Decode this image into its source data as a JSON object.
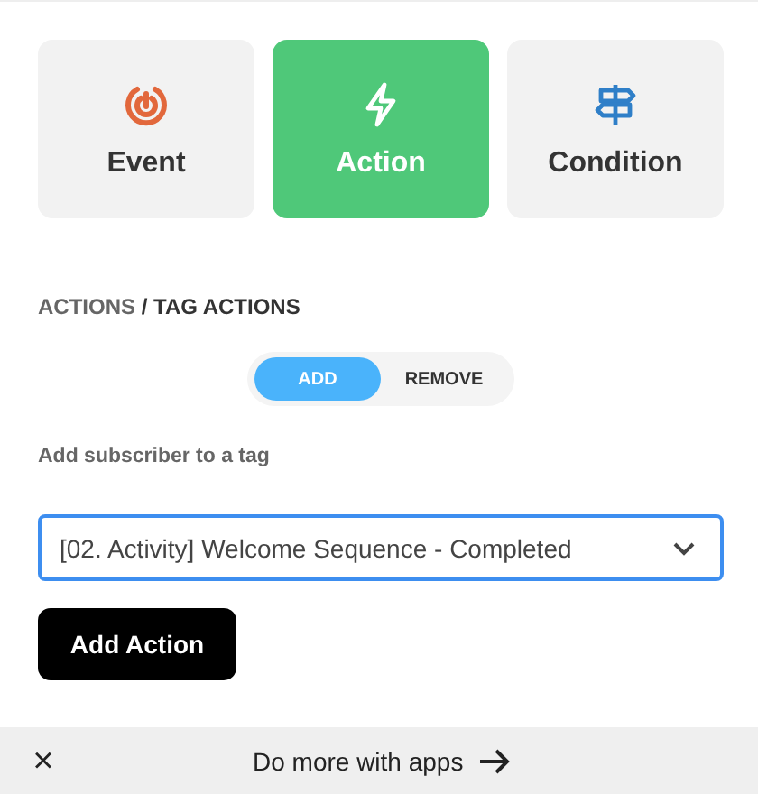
{
  "types": [
    {
      "kind": "event",
      "label": "Event",
      "selected": false
    },
    {
      "kind": "action",
      "label": "Action",
      "selected": true
    },
    {
      "kind": "condition",
      "label": "Condition",
      "selected": false
    }
  ],
  "breadcrumb": {
    "parent": "ACTIONS",
    "separator": "/",
    "current": "TAG ACTIONS"
  },
  "toggle": [
    {
      "label": "ADD",
      "selected": true
    },
    {
      "label": "REMOVE",
      "selected": false
    }
  ],
  "field_label": "Add subscriber to a tag",
  "tag_select": {
    "value": "[02. Activity] Welcome Sequence - Completed"
  },
  "submit_button": "Add Action",
  "banner": {
    "close": "×",
    "text": "Do more with apps"
  }
}
